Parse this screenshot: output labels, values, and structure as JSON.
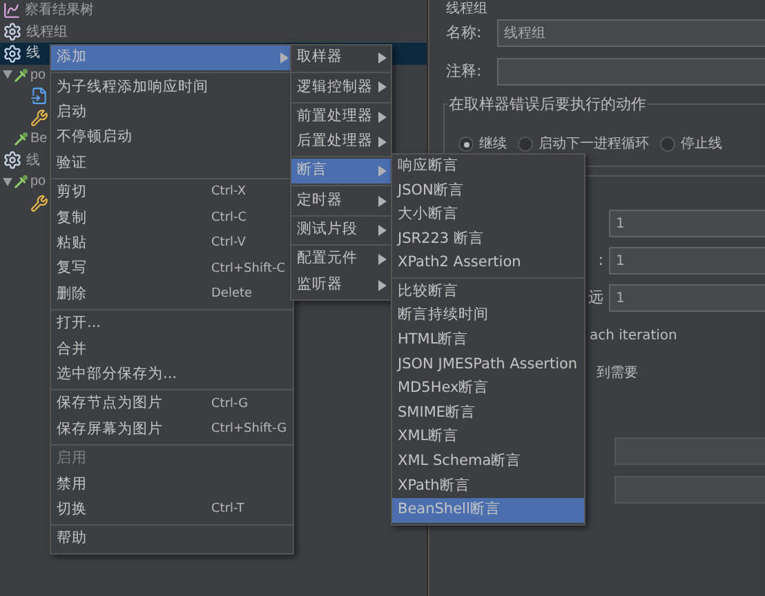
{
  "tree": [
    {
      "label": "察看结果树",
      "kind": "results",
      "selected": false
    },
    {
      "label": "线程组",
      "kind": "thread",
      "selected": false
    },
    {
      "label": "线",
      "kind": "thread",
      "selected": true,
      "children": [
        {
          "label": "po",
          "kind": "sampler",
          "selected": false,
          "expanded": true,
          "children": [
            {
              "kind": "doc",
              "selected": false
            },
            {
              "kind": "tool",
              "selected": false
            }
          ]
        },
        {
          "label": "Be",
          "kind": "sampler",
          "selected": false
        }
      ]
    },
    {
      "label": "线",
      "kind": "thread",
      "selected": false,
      "children": [
        {
          "label": "po",
          "kind": "sampler",
          "selected": false,
          "expanded": true,
          "children": [
            {
              "kind": "tool",
              "selected": false
            }
          ]
        }
      ]
    }
  ],
  "panel": {
    "heading": "线程组",
    "name_label": "名称:",
    "name_value": "线程组",
    "comment_label": "注释:",
    "action_group": "在取样器错误后要执行的动作",
    "radios": [
      {
        "label": "继续",
        "selected": true
      },
      {
        "label": "启动下一进程循环",
        "selected": false
      },
      {
        "label": "停止线",
        "selected": false
      }
    ],
    "number_fields": [
      {
        "value": "1"
      },
      {
        "label": ":",
        "value": "1"
      },
      {
        "label": "远",
        "value": "1"
      }
    ],
    "check_texts": [
      "ach iteration",
      "到需要"
    ]
  },
  "context_menu": {
    "groups": [
      [
        {
          "label": "添加",
          "submenu": true,
          "selected": true
        }
      ],
      [
        {
          "label": "为子线程添加响应时间",
          "selected": false
        },
        {
          "label": "启动",
          "selected": false
        },
        {
          "label": "不停顿启动",
          "selected": false
        },
        {
          "label": "验证",
          "selected": false
        }
      ],
      [
        {
          "label": "剪切",
          "shortcut": "Ctrl-X",
          "selected": false
        },
        {
          "label": "复制",
          "shortcut": "Ctrl-C",
          "selected": false
        },
        {
          "label": "粘贴",
          "shortcut": "Ctrl-V",
          "selected": false
        },
        {
          "label": "复写",
          "shortcut": "Ctrl+Shift-C",
          "selected": false
        },
        {
          "label": "删除",
          "shortcut": "Delete",
          "selected": false
        }
      ],
      [
        {
          "label": "打开...",
          "selected": false
        },
        {
          "label": "合并",
          "selected": false
        },
        {
          "label": "选中部分保存为...",
          "selected": false
        }
      ],
      [
        {
          "label": "保存节点为图片",
          "shortcut": "Ctrl-G",
          "selected": false
        },
        {
          "label": "保存屏幕为图片",
          "shortcut": "Ctrl+Shift-G",
          "selected": false
        }
      ],
      [
        {
          "label": "启用",
          "disabled": true,
          "selected": false
        },
        {
          "label": "禁用",
          "selected": false
        },
        {
          "label": "切换",
          "shortcut": "Ctrl-T",
          "selected": false
        }
      ],
      [
        {
          "label": "帮助",
          "selected": false
        }
      ]
    ]
  },
  "add_menu": {
    "groups": [
      [
        {
          "label": "取样器",
          "selected": false
        }
      ],
      [
        {
          "label": "逻辑控制器",
          "selected": false
        }
      ],
      [
        {
          "label": "前置处理器",
          "selected": false
        },
        {
          "label": "后置处理器",
          "selected": false
        }
      ],
      [
        {
          "label": "断言",
          "selected": true
        }
      ],
      [
        {
          "label": "定时器",
          "selected": false
        }
      ],
      [
        {
          "label": "测试片段",
          "selected": false
        }
      ],
      [
        {
          "label": "配置元件",
          "selected": false
        },
        {
          "label": "监听器",
          "selected": false
        }
      ]
    ]
  },
  "assertion_menu": {
    "groups": [
      [
        {
          "label": "响应断言",
          "selected": false
        },
        {
          "label": "JSON断言",
          "selected": false
        },
        {
          "label": "大小断言",
          "selected": false
        },
        {
          "label": "JSR223 断言",
          "selected": false
        },
        {
          "label": "XPath2 Assertion",
          "selected": false
        }
      ],
      [
        {
          "label": "比较断言",
          "selected": false
        },
        {
          "label": "断言持续时间",
          "selected": false
        },
        {
          "label": "HTML断言",
          "selected": false
        },
        {
          "label": "JSON JMESPath Assertion",
          "selected": false
        },
        {
          "label": "MD5Hex断言",
          "selected": false
        },
        {
          "label": "SMIME断言",
          "selected": false
        },
        {
          "label": "XML断言",
          "selected": false
        },
        {
          "label": "XML Schema断言",
          "selected": false
        },
        {
          "label": "XPath断言",
          "selected": false
        },
        {
          "label": "BeanShell断言",
          "selected": true
        }
      ]
    ]
  }
}
